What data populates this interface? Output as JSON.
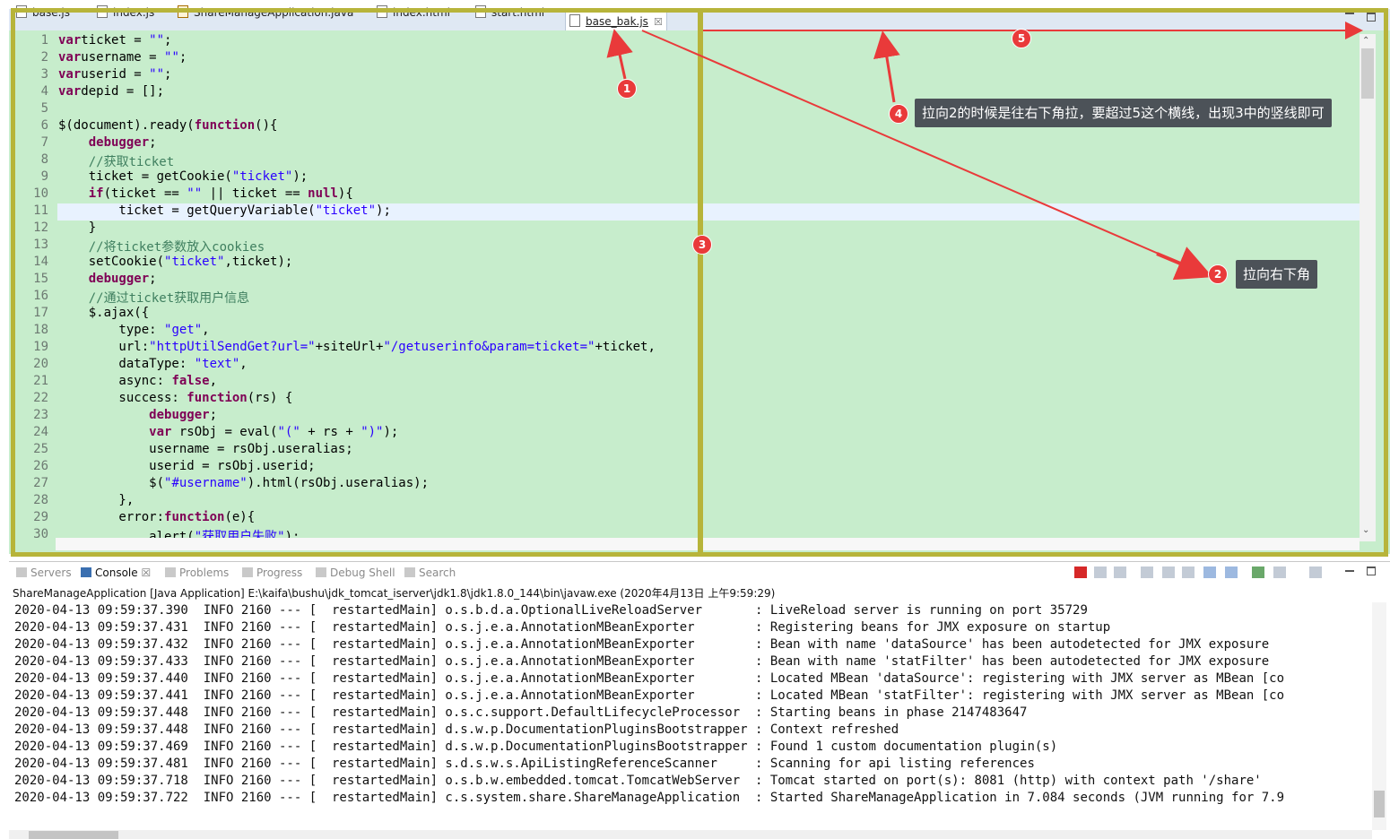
{
  "editor_tabs": [
    {
      "label": "base.js"
    },
    {
      "label": "index.js"
    },
    {
      "label": "ShareManageApplication.java"
    },
    {
      "label": "index.html"
    },
    {
      "label": "start.html"
    },
    {
      "label": "base_bak.js",
      "close": "☒"
    }
  ],
  "code_lines": [
    [
      "1",
      [
        [
          "kw",
          "var"
        ],
        [
          "",
          "ticket = "
        ],
        [
          "str",
          "\"\""
        ],
        [
          "",
          ";"
        ]
      ]
    ],
    [
      "2",
      [
        [
          "kw",
          "var"
        ],
        [
          "",
          "username = "
        ],
        [
          "str",
          "\"\""
        ],
        [
          "",
          ";"
        ]
      ]
    ],
    [
      "3",
      [
        [
          "kw",
          "var"
        ],
        [
          "",
          "userid = "
        ],
        [
          "str",
          "\"\""
        ],
        [
          "",
          ";"
        ]
      ]
    ],
    [
      "4",
      [
        [
          "kw",
          "var"
        ],
        [
          "",
          "depid = [];"
        ]
      ]
    ],
    [
      "5",
      []
    ],
    [
      "6",
      [
        [
          "",
          "$(document).ready("
        ],
        [
          "kw",
          "function"
        ],
        [
          "",
          "(){"
        ]
      ]
    ],
    [
      "7",
      [
        [
          "",
          "    "
        ],
        [
          "kw",
          "debugger"
        ],
        [
          "",
          ";"
        ]
      ]
    ],
    [
      "8",
      [
        [
          "",
          "    "
        ],
        [
          "cmt",
          "//获取ticket"
        ]
      ]
    ],
    [
      "9",
      [
        [
          "",
          "    ticket = getCookie("
        ],
        [
          "str",
          "\"ticket\""
        ],
        [
          "",
          ");"
        ]
      ]
    ],
    [
      "10",
      [
        [
          "",
          "    "
        ],
        [
          "kw",
          "if"
        ],
        [
          "",
          "(ticket == "
        ],
        [
          "str",
          "\"\""
        ],
        [
          "",
          " || ticket == "
        ],
        [
          "kw",
          "null"
        ],
        [
          "",
          "){"
        ]
      ]
    ],
    [
      "11",
      [
        [
          "",
          "        ticket = getQueryVariable("
        ],
        [
          "str",
          "\"ticket\""
        ],
        [
          "",
          ");"
        ]
      ]
    ],
    [
      "12",
      [
        [
          "",
          "    }"
        ]
      ]
    ],
    [
      "13",
      [
        [
          "",
          "    "
        ],
        [
          "cmt",
          "//将ticket参数放入cookies"
        ]
      ]
    ],
    [
      "14",
      [
        [
          "",
          "    setCookie("
        ],
        [
          "str",
          "\"ticket\""
        ],
        [
          "",
          ",ticket);"
        ]
      ]
    ],
    [
      "15",
      [
        [
          "",
          "    "
        ],
        [
          "kw",
          "debugger"
        ],
        [
          "",
          ";"
        ]
      ]
    ],
    [
      "16",
      [
        [
          "",
          "    "
        ],
        [
          "cmt",
          "//通过ticket获取用户信息"
        ]
      ]
    ],
    [
      "17",
      [
        [
          "",
          "    $.ajax({"
        ]
      ]
    ],
    [
      "18",
      [
        [
          "",
          "        type: "
        ],
        [
          "str",
          "\"get\""
        ],
        [
          "",
          ","
        ]
      ]
    ],
    [
      "19",
      [
        [
          "",
          "        url:"
        ],
        [
          "str",
          "\"httpUtilSendGet?url=\""
        ],
        [
          "",
          "+siteUrl+"
        ],
        [
          "str",
          "\"/getuserinfo&param=ticket=\""
        ],
        [
          "",
          "+ticket,"
        ]
      ]
    ],
    [
      "20",
      [
        [
          "",
          "        dataType: "
        ],
        [
          "str",
          "\"text\""
        ],
        [
          "",
          ","
        ]
      ]
    ],
    [
      "21",
      [
        [
          "",
          "        async: "
        ],
        [
          "kw",
          "false"
        ],
        [
          "",
          ","
        ]
      ]
    ],
    [
      "22",
      [
        [
          "",
          "        success: "
        ],
        [
          "kw",
          "function"
        ],
        [
          "",
          "(rs) {"
        ]
      ]
    ],
    [
      "23",
      [
        [
          "",
          "            "
        ],
        [
          "kw",
          "debugger"
        ],
        [
          "",
          ";"
        ]
      ]
    ],
    [
      "24",
      [
        [
          "",
          "            "
        ],
        [
          "kw",
          "var"
        ],
        [
          "",
          " rsObj = eval("
        ],
        [
          "str",
          "\"(\""
        ],
        [
          "",
          " + rs + "
        ],
        [
          "str",
          "\")\""
        ],
        [
          "",
          ");"
        ]
      ]
    ],
    [
      "25",
      [
        [
          "",
          "            username = rsObj.useralias;"
        ]
      ]
    ],
    [
      "26",
      [
        [
          "",
          "            userid = rsObj.userid;"
        ]
      ]
    ],
    [
      "27",
      [
        [
          "",
          "            $("
        ],
        [
          "str",
          "\"#username\""
        ],
        [
          "",
          ").html(rsObj.useralias);"
        ]
      ]
    ],
    [
      "28",
      [
        [
          "",
          "        },"
        ]
      ]
    ],
    [
      "29",
      [
        [
          "",
          "        error:"
        ],
        [
          "kw",
          "function"
        ],
        [
          "",
          "(e){"
        ]
      ]
    ],
    [
      "30",
      [
        [
          "",
          "            alert("
        ],
        [
          "str",
          "\"获取用户失败\""
        ],
        [
          "",
          ");"
        ]
      ]
    ]
  ],
  "annotations": {
    "b1": "1",
    "b2": "2",
    "b3": "3",
    "b4": "4",
    "b5": "5",
    "tip2": "拉向右下角",
    "tip4": "拉向2的时候是往右下角拉，要超过5这个横线，出现3中的竖线即可"
  },
  "view_tabs": [
    {
      "label": "Servers",
      "active": false
    },
    {
      "label": "Console",
      "active": true,
      "close": "☒"
    },
    {
      "label": "Problems",
      "active": false
    },
    {
      "label": "Progress",
      "active": false
    },
    {
      "label": "Debug Shell",
      "active": false
    },
    {
      "label": "Search",
      "active": false
    }
  ],
  "console_header": "ShareManageApplication [Java Application] E:\\kaifa\\bushu\\jdk_tomcat_iserver\\jdk1.8\\jdk1.8.0_144\\bin\\javaw.exe (2020年4月13日 上午9:59:29)",
  "log_lines": [
    "2020-04-13 09:59:37.390  INFO 2160 --- [  restartedMain] o.s.b.d.a.OptionalLiveReloadServer       : LiveReload server is running on port 35729",
    "2020-04-13 09:59:37.431  INFO 2160 --- [  restartedMain] o.s.j.e.a.AnnotationMBeanExporter        : Registering beans for JMX exposure on startup",
    "2020-04-13 09:59:37.432  INFO 2160 --- [  restartedMain] o.s.j.e.a.AnnotationMBeanExporter        : Bean with name 'dataSource' has been autodetected for JMX exposure",
    "2020-04-13 09:59:37.433  INFO 2160 --- [  restartedMain] o.s.j.e.a.AnnotationMBeanExporter        : Bean with name 'statFilter' has been autodetected for JMX exposure",
    "2020-04-13 09:59:37.440  INFO 2160 --- [  restartedMain] o.s.j.e.a.AnnotationMBeanExporter        : Located MBean 'dataSource': registering with JMX server as MBean [co",
    "2020-04-13 09:59:37.441  INFO 2160 --- [  restartedMain] o.s.j.e.a.AnnotationMBeanExporter        : Located MBean 'statFilter': registering with JMX server as MBean [co",
    "2020-04-13 09:59:37.448  INFO 2160 --- [  restartedMain] o.s.c.support.DefaultLifecycleProcessor  : Starting beans in phase 2147483647",
    "2020-04-13 09:59:37.448  INFO 2160 --- [  restartedMain] d.s.w.p.DocumentationPluginsBootstrapper : Context refreshed",
    "2020-04-13 09:59:37.469  INFO 2160 --- [  restartedMain] d.s.w.p.DocumentationPluginsBootstrapper : Found 1 custom documentation plugin(s)",
    "2020-04-13 09:59:37.481  INFO 2160 --- [  restartedMain] s.d.s.w.s.ApiListingReferenceScanner     : Scanning for api listing references",
    "2020-04-13 09:59:37.718  INFO 2160 --- [  restartedMain] o.s.b.w.embedded.tomcat.TomcatWebServer  : Tomcat started on port(s): 8081 (http) with context path '/share'",
    "2020-04-13 09:59:37.722  INFO 2160 --- [  restartedMain] c.s.system.share.ShareManageApplication  : Started ShareManageApplication in 7.084 seconds (JVM running for 7.9"
  ],
  "colors": {
    "annotation_red": "#e93a3a",
    "split_frame": "#b7b43a",
    "editor_bg": "#c7edcc"
  }
}
